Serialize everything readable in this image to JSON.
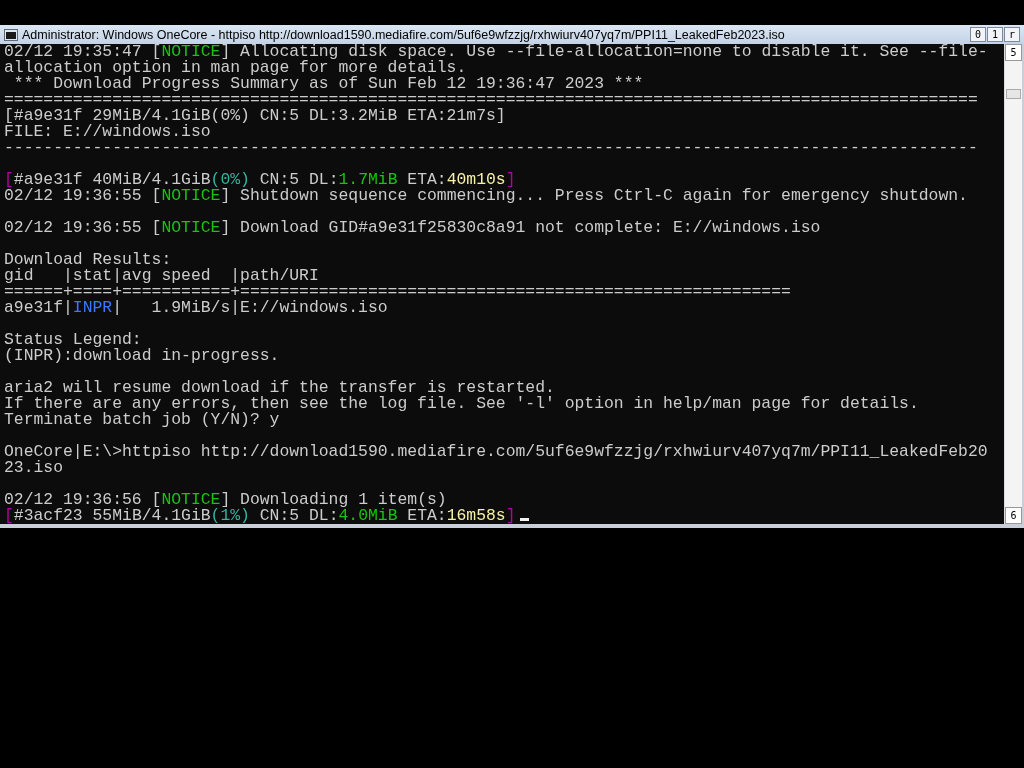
{
  "window": {
    "title": "Administrator:  Windows OneCore - httpiso  http://download1590.mediafire.com/5uf6e9wfzzjg/rxhwiurv407yq7m/PPI11_LeakedFeb2023.iso",
    "buttons": [
      "0",
      "1",
      "r"
    ]
  },
  "scrollbar": {
    "up": "5",
    "down": "6"
  },
  "terminal": {
    "cursor_visible": true,
    "lines": [
      {
        "kind": "text",
        "segments": [
          {
            "text": "02/12 19:35:47 ["
          },
          {
            "text": "NOTICE",
            "color": "#16c60c"
          },
          {
            "text": "] Allocating disk space. Use --file-allocation=none to disable it. See --file-"
          }
        ]
      },
      {
        "kind": "text",
        "segments": [
          {
            "text": "allocation option in man page for more details."
          }
        ]
      },
      {
        "kind": "text",
        "segments": [
          {
            "text": " *** Download Progress Summary as of Sun Feb 12 19:36:47 2023 ***"
          }
        ]
      },
      {
        "kind": "text",
        "segments": [
          {
            "text": "==================================================================================================="
          }
        ]
      },
      {
        "kind": "text",
        "segments": [
          {
            "text": "[#a9e31f 29MiB/4.1GiB(0%) CN:5 DL:3.2MiB ETA:21m7s]"
          }
        ]
      },
      {
        "kind": "text",
        "segments": [
          {
            "text": "FILE: E://windows.iso"
          }
        ]
      },
      {
        "kind": "text",
        "segments": [
          {
            "text": "---------------------------------------------------------------------------------------------------"
          }
        ]
      },
      {
        "kind": "blank"
      },
      {
        "kind": "text",
        "segments": [
          {
            "text": "[",
            "color": "#b4009e"
          },
          {
            "text": "#a9e31f 40MiB/4.1GiB"
          },
          {
            "text": "(0%)",
            "color": "#2fb5a0"
          },
          {
            "text": " CN:5 DL:"
          },
          {
            "text": "1.7MiB",
            "color": "#16c60c"
          },
          {
            "text": " ETA:"
          },
          {
            "text": "40m10s",
            "color": "#f9f1a5"
          },
          {
            "text": "]",
            "color": "#b4009e"
          }
        ]
      },
      {
        "kind": "text",
        "segments": [
          {
            "text": "02/12 19:36:55 ["
          },
          {
            "text": "NOTICE",
            "color": "#16c60c"
          },
          {
            "text": "] Shutdown sequence commencing... Press Ctrl-C again for emergency shutdown."
          }
        ]
      },
      {
        "kind": "blank"
      },
      {
        "kind": "text",
        "segments": [
          {
            "text": "02/12 19:36:55 ["
          },
          {
            "text": "NOTICE",
            "color": "#16c60c"
          },
          {
            "text": "] Download GID#a9e31f25830c8a91 not complete: E://windows.iso"
          }
        ]
      },
      {
        "kind": "blank"
      },
      {
        "kind": "text",
        "segments": [
          {
            "text": "Download Results:"
          }
        ]
      },
      {
        "kind": "text",
        "segments": [
          {
            "text": "gid   |stat|avg speed  |path/URI"
          }
        ]
      },
      {
        "kind": "text",
        "segments": [
          {
            "text": "======+====+===========+========================================================"
          }
        ]
      },
      {
        "kind": "text",
        "segments": [
          {
            "text": "a9e31f|"
          },
          {
            "text": "INPR",
            "color": "#3b78ff"
          },
          {
            "text": "|   1.9MiB/s|E://windows.iso"
          }
        ]
      },
      {
        "kind": "blank"
      },
      {
        "kind": "text",
        "segments": [
          {
            "text": "Status Legend:"
          }
        ]
      },
      {
        "kind": "text",
        "segments": [
          {
            "text": "(INPR):download in-progress."
          }
        ]
      },
      {
        "kind": "blank"
      },
      {
        "kind": "text",
        "segments": [
          {
            "text": "aria2 will resume download if the transfer is restarted."
          }
        ]
      },
      {
        "kind": "text",
        "segments": [
          {
            "text": "If there are any errors, then see the log file. See '-l' option in help/man page for details."
          }
        ]
      },
      {
        "kind": "text",
        "segments": [
          {
            "text": "Terminate batch job (Y/N)? y"
          }
        ]
      },
      {
        "kind": "blank"
      },
      {
        "kind": "text",
        "segments": [
          {
            "text": "OneCore|E:\\>httpiso http://download1590.mediafire.com/5uf6e9wfzzjg/rxhwiurv407yq7m/PPI11_LeakedFeb20"
          }
        ]
      },
      {
        "kind": "text",
        "segments": [
          {
            "text": "23.iso"
          }
        ]
      },
      {
        "kind": "blank"
      },
      {
        "kind": "text",
        "segments": [
          {
            "text": "02/12 19:36:56 ["
          },
          {
            "text": "NOTICE",
            "color": "#16c60c"
          },
          {
            "text": "] Downloading 1 item(s)"
          }
        ]
      },
      {
        "kind": "text",
        "segments": [
          {
            "text": "[",
            "color": "#b4009e"
          },
          {
            "text": "#3acf23 55MiB/4.1GiB"
          },
          {
            "text": "(1%)",
            "color": "#2fb5a0"
          },
          {
            "text": " CN:5 DL:"
          },
          {
            "text": "4.0MiB",
            "color": "#16c60c"
          },
          {
            "text": " ETA:"
          },
          {
            "text": "16m58s",
            "color": "#f9f1a5"
          },
          {
            "text": "]",
            "color": "#b4009e"
          }
        ]
      }
    ]
  }
}
